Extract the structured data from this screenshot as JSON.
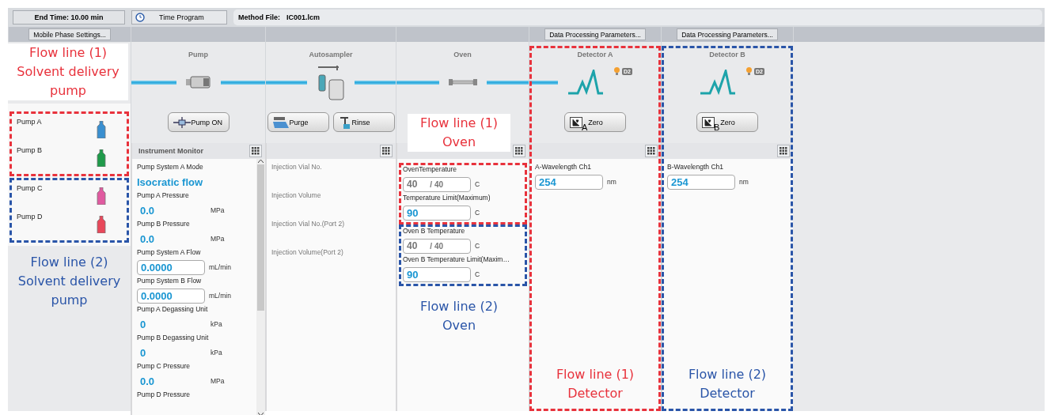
{
  "toolbar": {
    "end_time": "End Time: 10.00 min",
    "time_program": "Time Program",
    "method_file_label": "Method File:",
    "method_file": "IC001.lcm"
  },
  "mobile_phase_button": "Mobile Phase Settings...",
  "reservoir_groups": [
    {
      "color": "#e8323c",
      "reservoirs": [
        {
          "label": "Pump A",
          "color": "#3a8fd0"
        },
        {
          "label": "Pump B",
          "color": "#1f9a4a"
        }
      ]
    },
    {
      "color": "#2a55a8",
      "reservoirs": [
        {
          "label": "Pump C",
          "color": "#e05aa0"
        },
        {
          "label": "Pump D",
          "color": "#e8485a"
        }
      ]
    }
  ],
  "units": [
    {
      "kind": "pump",
      "title": "Pump",
      "buttons": [
        {
          "kind": "pump",
          "label": "Pump ON"
        }
      ],
      "monitor": {
        "title": "Instrument Monitor",
        "scrollbar": true,
        "groups": [
          {
            "items": [
              {
                "kind": "mode",
                "label": "Pump System A Mode",
                "value": "Isocratic flow"
              },
              {
                "kind": "reading",
                "label": "Pump A Pressure",
                "value": "0.0",
                "unit": "MPa"
              },
              {
                "kind": "reading",
                "label": "Pump B Pressure",
                "value": "0.0",
                "unit": "MPa"
              },
              {
                "kind": "field",
                "label": "Pump System A Flow",
                "value": "0.0000",
                "unit": "mL/min"
              },
              {
                "kind": "field",
                "label": "Pump System B Flow",
                "value": "0.0000",
                "unit": "mL/min"
              },
              {
                "kind": "reading",
                "label": "Pump A Degassing Unit",
                "value": "0",
                "unit": "kPa"
              },
              {
                "kind": "reading",
                "label": "Pump B Degassing Unit",
                "value": "0",
                "unit": "kPa"
              },
              {
                "kind": "reading",
                "label": "Pump C Pressure",
                "value": "0.0",
                "unit": "MPa"
              },
              {
                "kind": "label",
                "label": "Pump D Pressure"
              }
            ]
          }
        ]
      }
    },
    {
      "kind": "autosampler",
      "title": "Autosampler",
      "buttons": [
        {
          "kind": "purge",
          "label": "Purge"
        },
        {
          "kind": "rinse",
          "label": "Rinse"
        }
      ],
      "monitor": {
        "groups": [
          {
            "items": [
              {
                "kind": "label",
                "label": "Injection Vial No."
              },
              {
                "kind": "label",
                "label": "Injection Volume"
              },
              {
                "kind": "label",
                "label": "Injection Vial No.(Port 2)"
              },
              {
                "kind": "label",
                "label": "Injection Volume(Port 2)"
              }
            ]
          }
        ]
      }
    },
    {
      "kind": "oven",
      "title": "Oven",
      "monitor": {
        "groups": [
          {
            "color": "#e8323c",
            "items": [
              {
                "kind": "temp",
                "label": "OvenTemperature",
                "value": "40",
                "target": "/ 40",
                "unit": "C"
              },
              {
                "kind": "field",
                "label": "Temperature Limit(Maximum)",
                "value": "90",
                "unit": "C"
              }
            ]
          },
          {
            "color": "#2a55a8",
            "items": [
              {
                "kind": "temp",
                "label": "Oven B Temperature",
                "value": "40",
                "target": "/ 40",
                "unit": "C"
              },
              {
                "kind": "field",
                "label": "Oven B Temperature Limit(Maxim…",
                "value": "90",
                "unit": "C"
              }
            ]
          }
        ]
      }
    },
    {
      "kind": "detector",
      "title": "Detector A",
      "color": "#e8323c",
      "settings_button": "Data Processing Parameters...",
      "lamp": "D2",
      "buttons": [
        {
          "kind": "zero",
          "label": "Zero",
          "channel": "A"
        }
      ],
      "monitor": {
        "groups": [
          {
            "items": [
              {
                "kind": "field",
                "label": "A-Wavelength Ch1",
                "value": "254",
                "unit": "nm"
              }
            ]
          }
        ]
      }
    },
    {
      "kind": "detector",
      "title": "Detector B",
      "color": "#2a55a8",
      "settings_button": "Data Processing Parameters...",
      "lamp": "D2",
      "buttons": [
        {
          "kind": "zero",
          "label": "Zero",
          "channel": "B"
        }
      ],
      "monitor": {
        "groups": [
          {
            "items": [
              {
                "kind": "field",
                "label": "B-Wavelength Ch1",
                "value": "254",
                "unit": "nm"
              }
            ]
          }
        ]
      }
    }
  ],
  "annotations": [
    {
      "color": "#e8323c",
      "text": "Flow line (1) Solvent delivery pump"
    },
    {
      "color": "#2a55a8",
      "text": "Flow line (2) Solvent delivery pump"
    },
    {
      "color": "#e8323c",
      "text": "Flow line (1) Oven"
    },
    {
      "color": "#2a55a8",
      "text": "Flow line (2) Oven"
    },
    {
      "color": "#e8323c",
      "text": "Flow line (1) Detector"
    },
    {
      "color": "#2a55a8",
      "text": "Flow line (2) Detector"
    }
  ]
}
